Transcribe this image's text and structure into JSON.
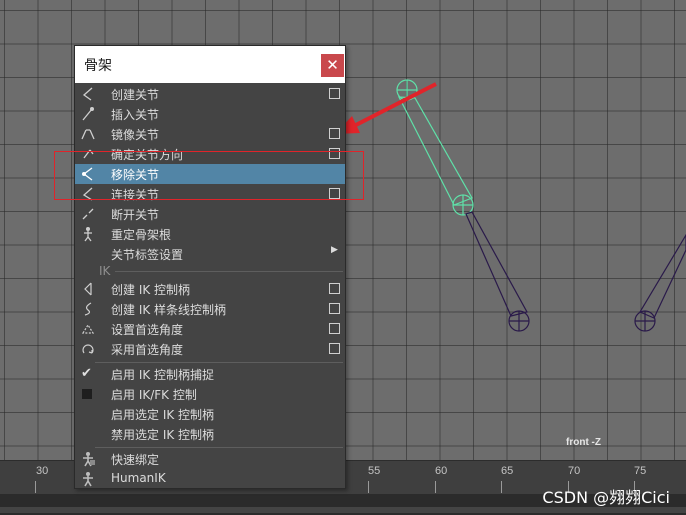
{
  "menu": {
    "title": "骨架",
    "close_glyph": "✕",
    "items": [
      {
        "label": "创建关节",
        "icon": "create-joint-icon",
        "has_option": true
      },
      {
        "label": "插入关节",
        "icon": "insert-joint-icon",
        "has_option": false
      },
      {
        "label": "镜像关节",
        "icon": "mirror-joint-icon",
        "has_option": true
      },
      {
        "label": "确定关节方向",
        "icon": "orient-joint-icon",
        "has_option": true
      },
      {
        "label": "移除关节",
        "icon": "remove-joint-icon",
        "has_option": false,
        "highlighted": true
      },
      {
        "label": "连接关节",
        "icon": "connect-joint-icon",
        "has_option": true
      },
      {
        "label": "断开关节",
        "icon": "disconnect-joint-icon",
        "has_option": false
      },
      {
        "label": "重定骨架根",
        "icon": "reroot-skeleton-icon",
        "has_option": false
      },
      {
        "label": "关节标签设置",
        "icon": "",
        "has_submenu": true
      }
    ],
    "ik_section_label": "IK",
    "ik_items": [
      {
        "label": "创建 IK 控制柄",
        "icon": "ik-handle-icon",
        "has_option": true
      },
      {
        "label": "创建 IK 样条线控制柄",
        "icon": "ik-spline-icon",
        "has_option": true
      },
      {
        "label": "设置首选角度",
        "icon": "set-preferred-angle-icon",
        "has_option": true
      },
      {
        "label": "采用首选角度",
        "icon": "assume-preferred-angle-icon",
        "has_option": true
      }
    ],
    "toggle_items": [
      {
        "label": "启用 IK 控制柄捕捉",
        "checked": true
      },
      {
        "label": "启用 IK/FK 控制",
        "checked": false
      }
    ],
    "plain_items": [
      {
        "label": "启用选定 IK 控制柄"
      },
      {
        "label": "禁用选定 IK 控制柄"
      }
    ],
    "bottom_items": [
      {
        "label": "快速绑定",
        "icon": "quick-rig-icon"
      },
      {
        "label": "HumanIK",
        "icon": "humanik-icon"
      }
    ]
  },
  "viewport": {
    "camera_label": "front -Z"
  },
  "timeline": {
    "ticks": [
      "30",
      "55",
      "60",
      "65",
      "70",
      "75"
    ]
  },
  "watermark": "CSDN @翙翙Cici",
  "colors": {
    "selected_joint": "#5fe0a8",
    "joint": "#2a1a4a",
    "highlight_row": "#5285a6",
    "annotation": "#e0242a",
    "close_button": "#c9484c"
  }
}
